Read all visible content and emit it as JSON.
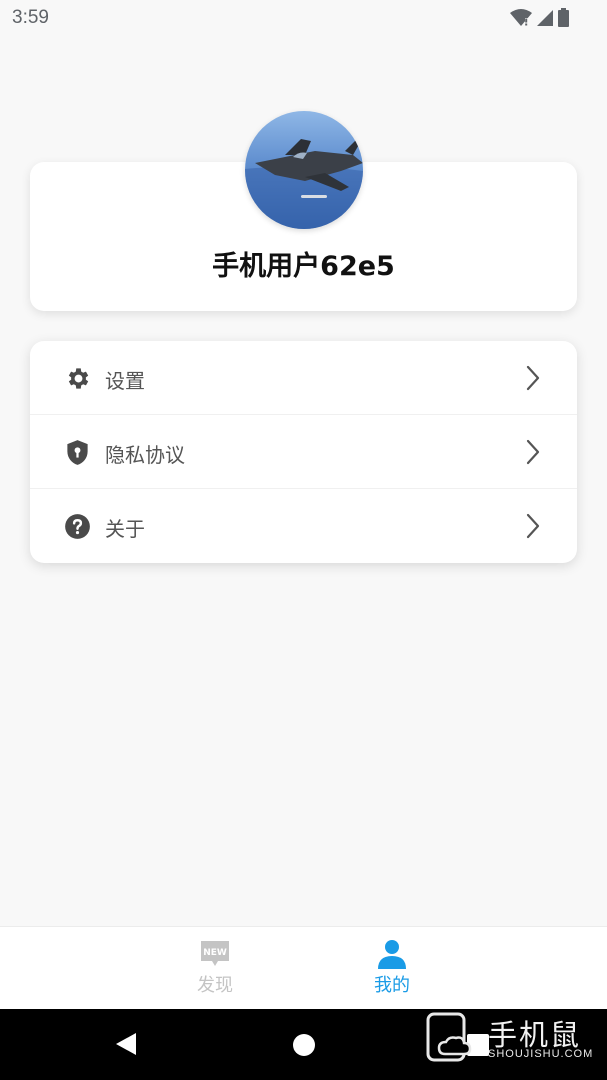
{
  "status_bar": {
    "time": "3:59",
    "icons": [
      "wifi-icon",
      "signal-icon",
      "battery-icon"
    ]
  },
  "profile": {
    "avatar_icon": "fighter-jet-avatar",
    "username": "手机用户62e5"
  },
  "menu": {
    "items": [
      {
        "label": "设置",
        "icon": "gear-icon"
      },
      {
        "label": "隐私协议",
        "icon": "shield-keyhole-icon"
      },
      {
        "label": "关于",
        "icon": "question-circle-icon"
      }
    ]
  },
  "tab_bar": {
    "tabs": [
      {
        "label": "发现",
        "icon": "new-badge-icon",
        "icon_text": "NEW",
        "active": false
      },
      {
        "label": "我的",
        "icon": "user-icon",
        "active": true
      }
    ]
  },
  "watermark": {
    "cn": "手机鼠",
    "en": "SHOUJISHU.COM"
  },
  "colors": {
    "accent": "#1a9be6",
    "inactive": "#c4c4c4",
    "background": "#f8f8f8",
    "card": "#ffffff"
  }
}
